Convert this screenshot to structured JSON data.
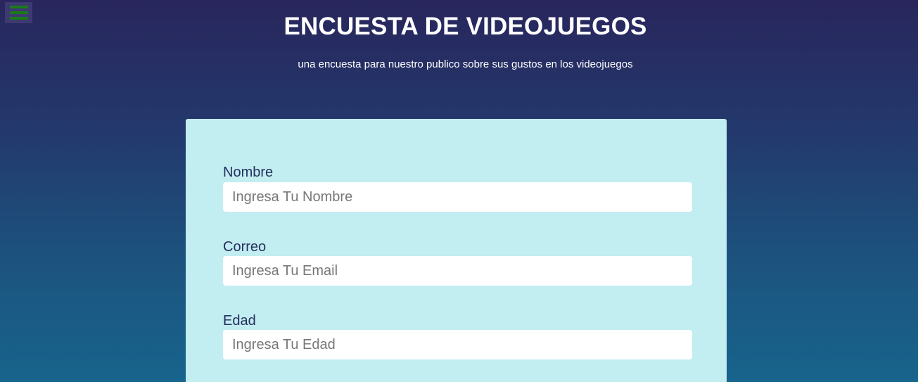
{
  "header": {
    "title": "ENCUESTA DE VIDEOJUEGOS",
    "subtitle": "una encuesta para nuestro publico sobre sus gustos en los videojuegos"
  },
  "menu": {
    "icon": "hamburger-menu-icon"
  },
  "form": {
    "fields": [
      {
        "label": "Nombre",
        "placeholder": "Ingresa Tu Nombre",
        "value": ""
      },
      {
        "label": "Correo",
        "placeholder": "Ingresa Tu Email",
        "value": ""
      },
      {
        "label": "Edad",
        "placeholder": "Ingresa Tu Edad",
        "value": ""
      }
    ]
  }
}
